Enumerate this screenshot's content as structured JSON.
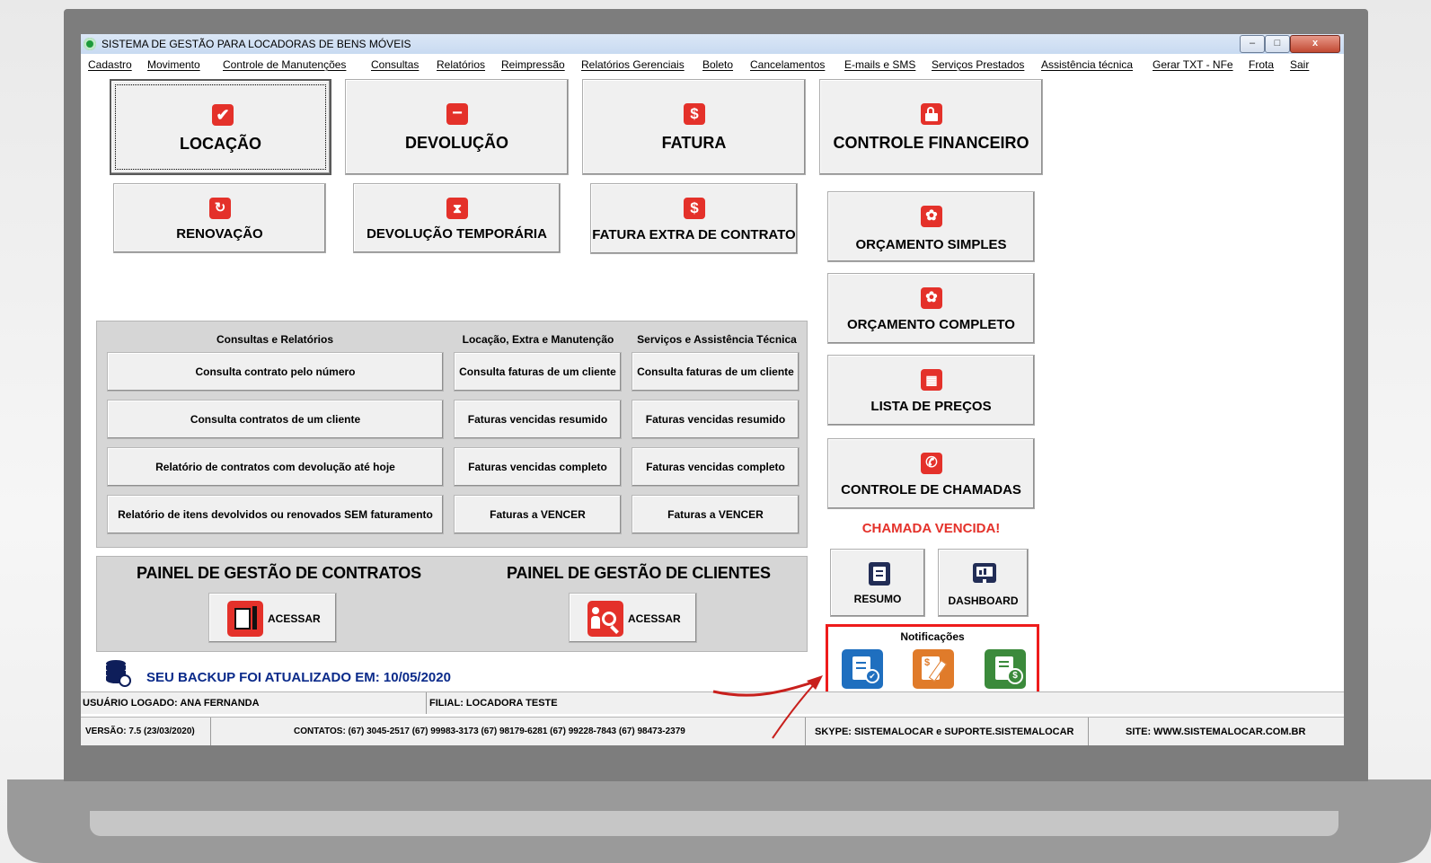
{
  "window": {
    "title": "SISTEMA DE GESTÃO PARA LOCADORAS DE BENS MÓVEIS",
    "controls": [
      "–",
      "□",
      "x"
    ]
  },
  "menu": [
    "Cadastro",
    "Movimento",
    "Controle de Manutenções",
    "Consultas",
    "Relatórios",
    "Reimpressão",
    "Relatórios Gerenciais",
    "Boleto",
    "Cancelamentos",
    "E-mails e SMS",
    "Serviços Prestados",
    "Assistência técnica",
    "Gerar TXT - NFe",
    "Frota",
    "Sair"
  ],
  "main_buttons": {
    "locacao": "LOCAÇÃO",
    "devolucao": "DEVOLUÇÃO",
    "fatura": "FATURA",
    "controle_financeiro": "CONTROLE FINANCEIRO",
    "renovacao": "RENOVAÇÃO",
    "devolucao_temporaria": "DEVOLUÇÃO TEMPORÁRIA",
    "fatura_extra": "FATURA EXTRA DE CONTRATO"
  },
  "right_buttons": {
    "orcamento_simples": "ORÇAMENTO SIMPLES",
    "orcamento_completo": "ORÇAMENTO COMPLETO",
    "lista_precos": "LISTA DE PREÇOS",
    "controle_chamadas": "CONTROLE DE CHAMADAS",
    "chamada_vencida": "CHAMADA VENCIDA!",
    "resumo": "RESUMO",
    "dashboard": "DASHBOARD",
    "notificacoes": "Notificações"
  },
  "consultas_panel": {
    "col1_title": "Consultas e Relatórios",
    "col2_title": "Locação, Extra e Manutenção",
    "col3_title": "Serviços e Assistência Técnica",
    "col1": [
      "Consulta contrato pelo número",
      "Consulta contratos de um cliente",
      "Relatório de contratos com devolução até hoje",
      "Relatório de itens devolvidos ou renovados SEM faturamento"
    ],
    "col2": [
      "Consulta faturas de um cliente",
      "Faturas vencidas resumido",
      "Faturas vencidas completo",
      "Faturas a VENCER"
    ],
    "col3": [
      "Consulta faturas de um cliente",
      "Faturas vencidas resumido",
      "Faturas vencidas completo",
      "Faturas a VENCER"
    ]
  },
  "paineis": {
    "contratos_title": "PAINEL DE GESTÃO DE CONTRATOS",
    "clientes_title": "PAINEL DE GESTÃO DE CLIENTES",
    "acessar": "ACESSAR"
  },
  "backup": "SEU BACKUP FOI ATUALIZADO EM: 10/05/2020",
  "status": {
    "usuario": "USUÁRIO LOGADO: ANA FERNANDA",
    "filial": "FILIAL: LOCADORA TESTE",
    "versao": "VERSÃO: 7.5 (23/03/2020)",
    "contatos": "CONTATOS: (67) 3045-2517   (67) 99983-3173   (67) 98179-6281   (67) 99228-7843   (67) 98473-2379",
    "skype": "SKYPE: SISTEMALOCAR e SUPORTE.SISTEMALOCAR",
    "site": "SITE: WWW.SISTEMALOCAR.COM.BR"
  },
  "colors": {
    "icon_red": "#e4312a",
    "alert_red": "#e4312a",
    "backup_blue": "#0a2a8a",
    "notif_blue": "#1f6fbf",
    "notif_orange": "#e07b2a",
    "notif_green": "#3b8a3b",
    "highlight_red": "#ee1c1c"
  }
}
